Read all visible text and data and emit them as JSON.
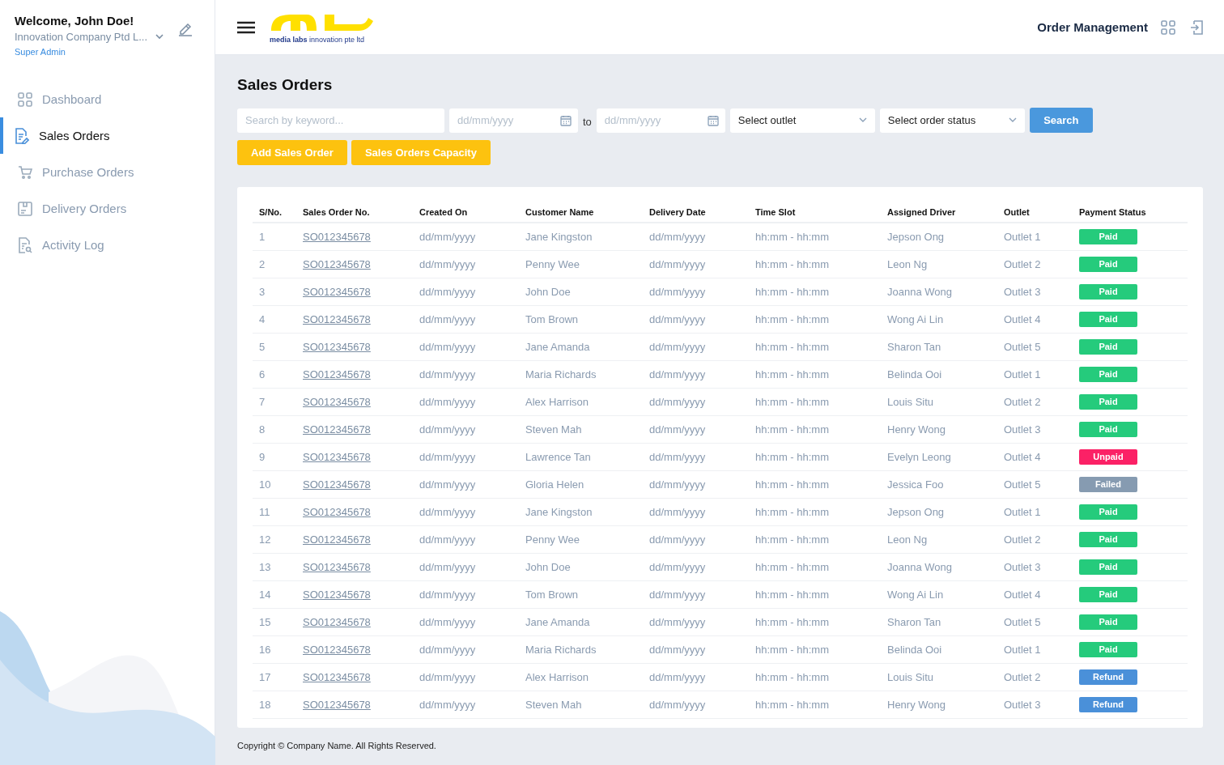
{
  "user": {
    "greeting": "Welcome, John Doe!",
    "company": "Innovation Company Ptd L...",
    "role": "Super Admin"
  },
  "nav": [
    {
      "label": "Dashboard",
      "selected": false
    },
    {
      "label": "Sales Orders",
      "selected": true
    },
    {
      "label": "Purchase Orders",
      "selected": false
    },
    {
      "label": "Delivery Orders",
      "selected": false
    },
    {
      "label": "Activity Log",
      "selected": false
    }
  ],
  "logo": {
    "tagline_bold": "media labs",
    "tagline": "innovation pte ltd"
  },
  "header": {
    "title": "Order Management"
  },
  "page_title": "Sales Orders",
  "filters": {
    "keyword": {
      "placeholder": "Search by keyword..."
    },
    "date_from": {
      "placeholder": "dd/mm/yyyy"
    },
    "to_label": "to",
    "date_to": {
      "placeholder": "dd/mm/yyyy"
    },
    "outlet": "Select outlet",
    "status": "Select order status",
    "search_button": "Search"
  },
  "actions": [
    "Add Sales Order",
    "Sales Orders Capacity"
  ],
  "table": {
    "columns": [
      "S/No.",
      "Sales Order No.",
      "Created On",
      "Customer Name",
      "Delivery Date",
      "Time Slot",
      "Assigned Driver",
      "Outlet",
      "Payment Status"
    ],
    "rows": [
      {
        "no": "1",
        "order": "SO012345678",
        "created": "dd/mm/yyyy",
        "customer": "Jane Kingston",
        "delivery": "dd/mm/yyyy",
        "slot": "hh:mm - hh:mm",
        "driver": "Jepson Ong",
        "outlet": "Outlet 1",
        "status": {
          "label": "Paid",
          "kind": "paid"
        }
      },
      {
        "no": "2",
        "order": "SO012345678",
        "created": "dd/mm/yyyy",
        "customer": "Penny Wee",
        "delivery": "dd/mm/yyyy",
        "slot": "hh:mm - hh:mm",
        "driver": "Leon Ng",
        "outlet": "Outlet 2",
        "status": {
          "label": "Paid",
          "kind": "paid"
        }
      },
      {
        "no": "3",
        "order": "SO012345678",
        "created": "dd/mm/yyyy",
        "customer": "John Doe",
        "delivery": "dd/mm/yyyy",
        "slot": "hh:mm - hh:mm",
        "driver": "Joanna Wong",
        "outlet": "Outlet 3",
        "status": {
          "label": "Paid",
          "kind": "paid"
        }
      },
      {
        "no": "4",
        "order": "SO012345678",
        "created": "dd/mm/yyyy",
        "customer": "Tom Brown",
        "delivery": "dd/mm/yyyy",
        "slot": "hh:mm - hh:mm",
        "driver": "Wong Ai Lin",
        "outlet": "Outlet 4",
        "status": {
          "label": "Paid",
          "kind": "paid"
        }
      },
      {
        "no": "5",
        "order": "SO012345678",
        "created": "dd/mm/yyyy",
        "customer": "Jane Amanda",
        "delivery": "dd/mm/yyyy",
        "slot": "hh:mm - hh:mm",
        "driver": "Sharon Tan",
        "outlet": "Outlet 5",
        "status": {
          "label": "Paid",
          "kind": "paid"
        }
      },
      {
        "no": "6",
        "order": "SO012345678",
        "created": "dd/mm/yyyy",
        "customer": "Maria Richards",
        "delivery": "dd/mm/yyyy",
        "slot": "hh:mm - hh:mm",
        "driver": "Belinda Ooi",
        "outlet": "Outlet 1",
        "status": {
          "label": "Paid",
          "kind": "paid"
        }
      },
      {
        "no": "7",
        "order": "SO012345678",
        "created": "dd/mm/yyyy",
        "customer": "Alex Harrison",
        "delivery": "dd/mm/yyyy",
        "slot": "hh:mm - hh:mm",
        "driver": "Louis Situ",
        "outlet": "Outlet 2",
        "status": {
          "label": "Paid",
          "kind": "paid"
        }
      },
      {
        "no": "8",
        "order": "SO012345678",
        "created": "dd/mm/yyyy",
        "customer": "Steven Mah",
        "delivery": "dd/mm/yyyy",
        "slot": "hh:mm - hh:mm",
        "driver": "Henry Wong",
        "outlet": "Outlet 3",
        "status": {
          "label": "Paid",
          "kind": "paid"
        }
      },
      {
        "no": "9",
        "order": "SO012345678",
        "created": "dd/mm/yyyy",
        "customer": "Lawrence Tan",
        "delivery": "dd/mm/yyyy",
        "slot": "hh:mm - hh:mm",
        "driver": "Evelyn Leong",
        "outlet": "Outlet 4",
        "status": {
          "label": "Unpaid",
          "kind": "unpaid"
        }
      },
      {
        "no": "10",
        "order": "SO012345678",
        "created": "dd/mm/yyyy",
        "customer": "Gloria Helen",
        "delivery": "dd/mm/yyyy",
        "slot": "hh:mm - hh:mm",
        "driver": "Jessica Foo",
        "outlet": "Outlet 5",
        "status": {
          "label": "Failed",
          "kind": "failed"
        }
      },
      {
        "no": "11",
        "order": "SO012345678",
        "created": "dd/mm/yyyy",
        "customer": "Jane Kingston",
        "delivery": "dd/mm/yyyy",
        "slot": "hh:mm - hh:mm",
        "driver": "Jepson Ong",
        "outlet": "Outlet 1",
        "status": {
          "label": "Paid",
          "kind": "paid"
        }
      },
      {
        "no": "12",
        "order": "SO012345678",
        "created": "dd/mm/yyyy",
        "customer": "Penny Wee",
        "delivery": "dd/mm/yyyy",
        "slot": "hh:mm - hh:mm",
        "driver": "Leon Ng",
        "outlet": "Outlet 2",
        "status": {
          "label": "Paid",
          "kind": "paid"
        }
      },
      {
        "no": "13",
        "order": "SO012345678",
        "created": "dd/mm/yyyy",
        "customer": "John Doe",
        "delivery": "dd/mm/yyyy",
        "slot": "hh:mm - hh:mm",
        "driver": "Joanna Wong",
        "outlet": "Outlet 3",
        "status": {
          "label": "Paid",
          "kind": "paid"
        }
      },
      {
        "no": "14",
        "order": "SO012345678",
        "created": "dd/mm/yyyy",
        "customer": "Tom Brown",
        "delivery": "dd/mm/yyyy",
        "slot": "hh:mm - hh:mm",
        "driver": "Wong Ai Lin",
        "outlet": "Outlet 4",
        "status": {
          "label": "Paid",
          "kind": "paid"
        }
      },
      {
        "no": "15",
        "order": "SO012345678",
        "created": "dd/mm/yyyy",
        "customer": "Jane Amanda",
        "delivery": "dd/mm/yyyy",
        "slot": "hh:mm - hh:mm",
        "driver": "Sharon Tan",
        "outlet": "Outlet 5",
        "status": {
          "label": "Paid",
          "kind": "paid"
        }
      },
      {
        "no": "16",
        "order": "SO012345678",
        "created": "dd/mm/yyyy",
        "customer": "Maria Richards",
        "delivery": "dd/mm/yyyy",
        "slot": "hh:mm - hh:mm",
        "driver": "Belinda Ooi",
        "outlet": "Outlet 1",
        "status": {
          "label": "Paid",
          "kind": "paid"
        }
      },
      {
        "no": "17",
        "order": "SO012345678",
        "created": "dd/mm/yyyy",
        "customer": "Alex Harrison",
        "delivery": "dd/mm/yyyy",
        "slot": "hh:mm - hh:mm",
        "driver": "Louis Situ",
        "outlet": "Outlet 2",
        "status": {
          "label": "Refund",
          "kind": "refund"
        }
      },
      {
        "no": "18",
        "order": "SO012345678",
        "created": "dd/mm/yyyy",
        "customer": "Steven Mah",
        "delivery": "dd/mm/yyyy",
        "slot": "hh:mm - hh:mm",
        "driver": "Henry Wong",
        "outlet": "Outlet 3",
        "status": {
          "label": "Refund",
          "kind": "refund"
        }
      }
    ]
  },
  "footer": "Copyright © Company Name. All Rights Reserved."
}
